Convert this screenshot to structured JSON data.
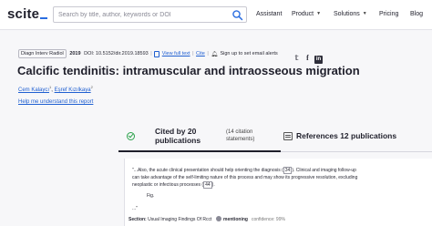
{
  "header": {
    "logo": "scite",
    "search_placeholder": "Search by title, author, keywords or DOI",
    "nav": {
      "assistant": "Assistant",
      "product": "Product",
      "solutions": "Solutions",
      "pricing": "Pricing",
      "blog": "Blog"
    }
  },
  "article": {
    "journal": "Diagn Interv Radiol",
    "year": "2019",
    "doi": "DOI: 10.5152/dir.2019.18593",
    "view_full_text": "View full text",
    "cite": "Cite",
    "alerts": "Sign up to set email alerts",
    "title": "Calcific tendinitis: intramuscular and intraosseous migration",
    "authors": [
      {
        "name": "Cem Kalaycı",
        "aff": "1"
      },
      {
        "name": "Eşref Kızılkaya",
        "aff": "2"
      }
    ],
    "help_link": "Help me understand this report"
  },
  "tabs": {
    "cited_label": "Cited by 20 publications",
    "cited_sub": "(14 citation statements)",
    "refs_label": "References 12 publications"
  },
  "citation": {
    "snippet_start": "\"...Also, the acute clinical presentation should help orienting the diagnosis (",
    "ref1": "34",
    "snippet_mid": "). Clinical and imaging follow-up can take advantage of the self-limiting nature of this process and may show its progressive resolution, excluding neoplastic or infectious processes (",
    "ref2": "44",
    "snippet_end": ").",
    "fig": "Fig.",
    "ellipsis": "...\"",
    "section_label": "Section:",
    "section_value": "Usual Imaging Findings Of Rcct",
    "mention": "mentioning",
    "confidence": "confidence: 99%"
  },
  "colors": {
    "accent": "#1f5fd1",
    "mention_green": "#2aa24a"
  }
}
